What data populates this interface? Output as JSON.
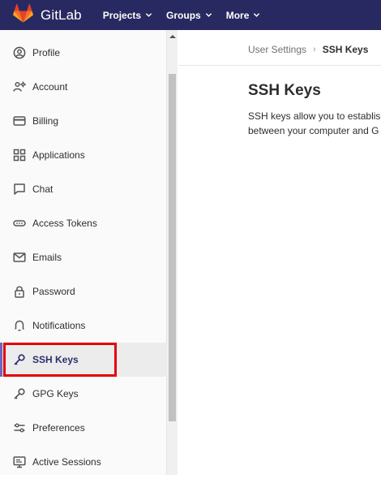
{
  "navbar": {
    "brand": "GitLab",
    "items": [
      {
        "label": "Projects"
      },
      {
        "label": "Groups"
      },
      {
        "label": "More"
      }
    ]
  },
  "sidebar": {
    "items": [
      {
        "label": "Profile",
        "icon": "profile-icon"
      },
      {
        "label": "Account",
        "icon": "account-icon"
      },
      {
        "label": "Billing",
        "icon": "billing-icon"
      },
      {
        "label": "Applications",
        "icon": "applications-icon"
      },
      {
        "label": "Chat",
        "icon": "chat-icon"
      },
      {
        "label": "Access Tokens",
        "icon": "access-tokens-icon"
      },
      {
        "label": "Emails",
        "icon": "email-icon"
      },
      {
        "label": "Password",
        "icon": "lock-icon"
      },
      {
        "label": "Notifications",
        "icon": "bell-icon"
      },
      {
        "label": "SSH Keys",
        "icon": "key-icon",
        "active": true
      },
      {
        "label": "GPG Keys",
        "icon": "key-icon"
      },
      {
        "label": "Preferences",
        "icon": "preferences-icon"
      },
      {
        "label": "Active Sessions",
        "icon": "monitor-icon"
      }
    ]
  },
  "breadcrumb": {
    "parent": "User Settings",
    "current": "SSH Keys"
  },
  "main": {
    "title": "SSH Keys",
    "description_line1": "SSH keys allow you to establis",
    "description_line2": "between your computer and G"
  },
  "colors": {
    "navbar_bg": "#292961",
    "active_accent": "#6666c4",
    "highlight": "#e60000"
  }
}
